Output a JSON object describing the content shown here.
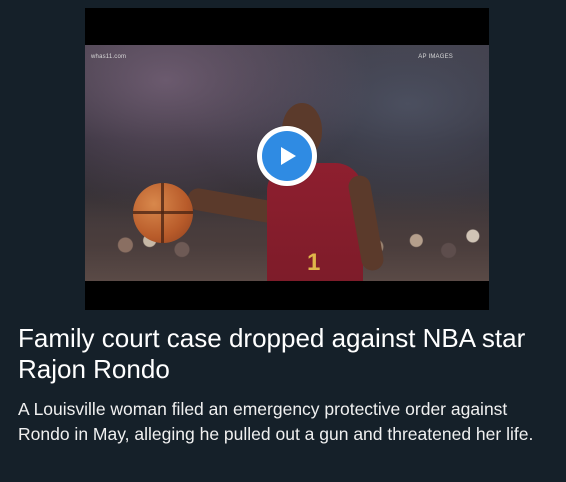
{
  "article": {
    "title": "Family court case dropped against NBA star Rajon Rondo",
    "summary": "A Louisville woman filed an emergency protective order against Rondo in May, alleging he pulled out a gun and threatened her life."
  },
  "video": {
    "watermark_left": "whas11.com",
    "watermark_right": "AP IMAGES",
    "jersey_number": "1",
    "play_icon": "play-icon"
  }
}
